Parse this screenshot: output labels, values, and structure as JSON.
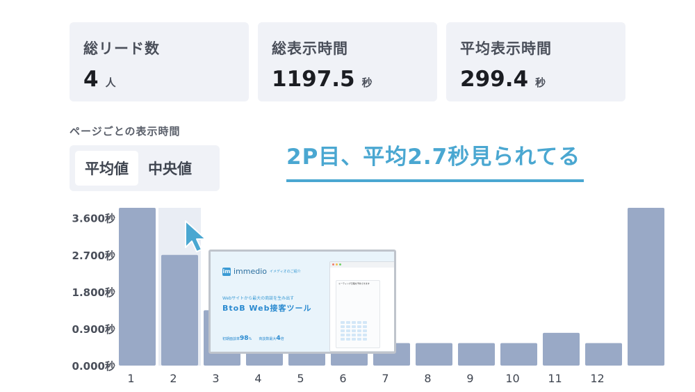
{
  "stats": [
    {
      "label": "総リード数",
      "value": "4",
      "unit": "人"
    },
    {
      "label": "総表示時間",
      "value": "1197.5",
      "unit": "秒"
    },
    {
      "label": "平均表示時間",
      "value": "299.4",
      "unit": "秒"
    }
  ],
  "section_title": "ページごとの表示時間",
  "toggle": {
    "average": "平均値",
    "median": "中央値",
    "selected": "平均値"
  },
  "headline": "2P目、平均2.7秒見られてる",
  "colors": {
    "bar": "#99a9c6",
    "highlight": "#e9edf4",
    "accent": "#4aa7d1",
    "card": "#f0f2f7"
  },
  "popup": {
    "logo": "immedio",
    "logo_mark": "im",
    "logo_sub": "イメディオのご紹介",
    "tagline": "Webサイトから最大の商談を生み出す",
    "heading": "BtoB Web接客ツール",
    "stat1_label": "初期面談率",
    "stat1_value": "98",
    "stat1_unit": "%",
    "stat2_label": "商談数最大",
    "stat2_value": "4",
    "stat2_unit": "倍",
    "window_title": "ミーティング日程を予約できます"
  },
  "chart_data": {
    "type": "bar",
    "categories": [
      "1",
      "2",
      "3",
      "4",
      "5",
      "6",
      "7",
      "8",
      "9",
      "10",
      "11",
      "12",
      ""
    ],
    "values": [
      3.85,
      2.7,
      1.35,
      0.55,
      0.55,
      0.55,
      0.55,
      0.55,
      0.55,
      0.55,
      0.8,
      0.55,
      3.85
    ],
    "y_ticks": [
      "3.600秒",
      "2.700秒",
      "1.800秒",
      "0.900秒",
      "0.000秒"
    ],
    "y_tick_values": [
      3.6,
      2.7,
      1.8,
      0.9,
      0.0
    ],
    "highlight_index": 1,
    "ylim": [
      0,
      3.85
    ]
  }
}
